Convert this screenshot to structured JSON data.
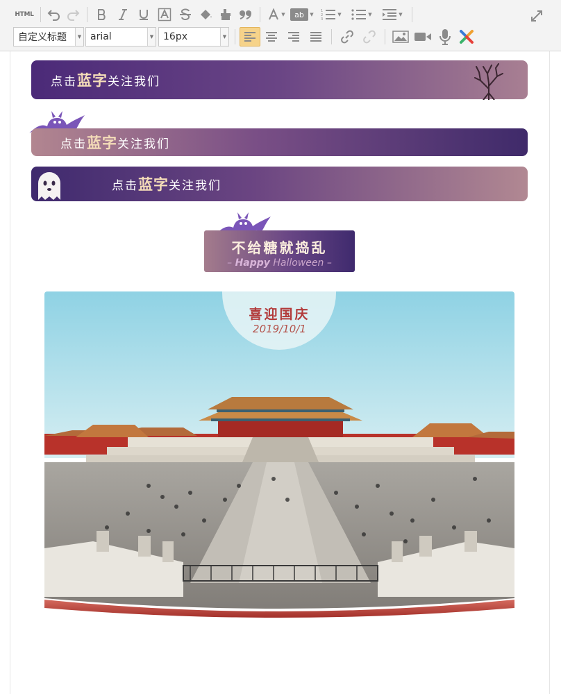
{
  "toolbar": {
    "html_label": "HTML",
    "heading_select": "自定义标题",
    "font_select": "arial",
    "size_select": "16px"
  },
  "banners": [
    {
      "prefix": "点击",
      "highlight": "蓝字",
      "suffix": "关注我们"
    },
    {
      "prefix": "点击",
      "highlight": "蓝字",
      "suffix": "关注我们"
    },
    {
      "prefix": "点击",
      "highlight": "蓝字",
      "suffix": "关注我们"
    }
  ],
  "halloween": {
    "title": "不给糖就捣乱",
    "subtitle_dash_left": "–",
    "subtitle_bold": "Happy",
    "subtitle_rest": "Halloween",
    "subtitle_dash_right": "–"
  },
  "photo_card": {
    "title": "喜迎国庆",
    "date": "2019/10/1"
  },
  "colors": {
    "purple_dark": "#3f2a6e",
    "purple_mid": "#6a4585",
    "rose": "#b28690",
    "highlight_text": "#f4dcb8",
    "badge_red": "#b23a3a",
    "active_button": "#f6d38a"
  },
  "icons": [
    "html-icon",
    "undo-icon",
    "redo-icon",
    "bold-icon",
    "italic-icon",
    "underline-icon",
    "font-border-icon",
    "strikethrough-icon",
    "font-color-icon",
    "format-painter-icon",
    "blockquote-icon",
    "font-size-icon",
    "highlight-icon",
    "ordered-list-icon",
    "unordered-list-icon",
    "indent-icon",
    "fullscreen-icon",
    "align-left-icon",
    "align-center-icon",
    "align-right-icon",
    "justify-icon",
    "link-icon",
    "unlink-icon",
    "image-icon",
    "video-icon",
    "audio-icon",
    "app-logo-icon",
    "bat-icon",
    "ghost-icon",
    "tree-icon"
  ]
}
